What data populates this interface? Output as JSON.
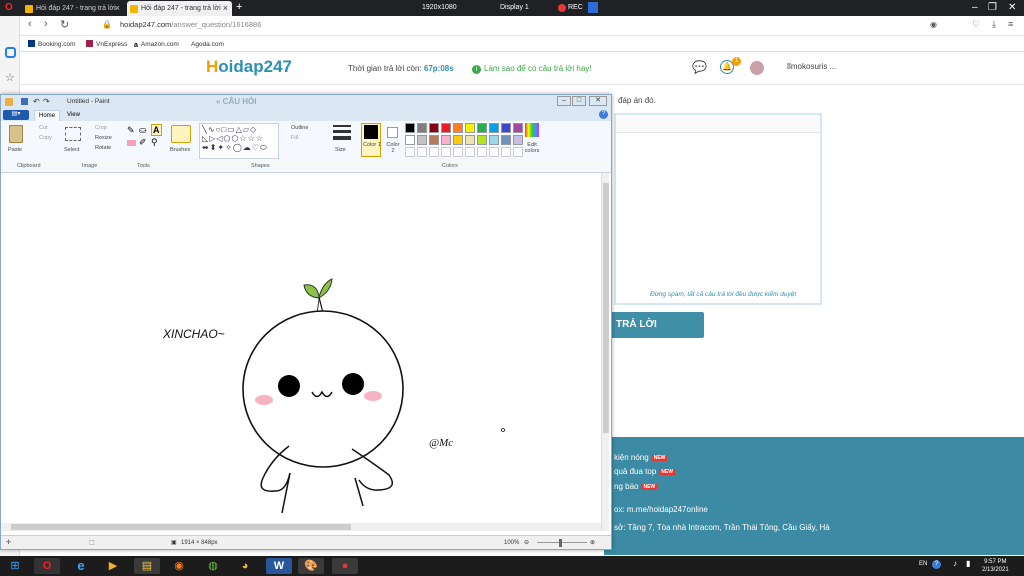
{
  "browser": {
    "tabs": [
      {
        "title": "Hỏi đáp 247 - trang trả lời"
      },
      {
        "title": "Hỏi đáp 247 - trang trả lời"
      }
    ],
    "url_host": "hoidap247.com",
    "url_path": "/answer_question/1616886",
    "bookmarks": [
      "Booking.com",
      "VnExpress",
      "Amazon.com",
      "Agoda.com"
    ],
    "recording": {
      "resolution": "1920x1080",
      "display": "Display 1",
      "rec_label": "REC"
    }
  },
  "site": {
    "logo_main": "oidap247",
    "logo_h": "H",
    "timer_label": "Thời gian trả lời còn:",
    "timer_value": "67p:08s",
    "howto": "Làm sao để có câu trả lời hay!",
    "notif_count": "1",
    "username": "ʬmokosuris ...",
    "notice": "đáp án đó.",
    "editor_note": "Đừng spam, tất cả câu trả lời đều được kiểm duyệt",
    "answer_button": "TRẢ LỜI",
    "footer_links": [
      {
        "label": "kiện nóng",
        "badge": "NEW"
      },
      {
        "label": "quả đua top",
        "badge": "NEW"
      },
      {
        "label": "ng báo",
        "badge": "NEW"
      }
    ],
    "footer_contact": "ox: m.me/hoidap247online",
    "footer_address": "sở: Tầng 7, Tòa nhà Intracom, Trần Thái Tông, Cầu Giấy, Hà"
  },
  "paint": {
    "title": "Untitled - Paint",
    "tabs": [
      "Home",
      "View"
    ],
    "clipboard": {
      "paste": "Paste",
      "cut": "Cut",
      "copy": "Copy",
      "group": "Clipboard"
    },
    "image": {
      "select": "Select",
      "crop": "Crop",
      "resize": "Resize",
      "rotate": "Rotate",
      "group": "Image"
    },
    "tools_group": "Tools",
    "brushes": "Brushes",
    "shapes": {
      "outline": "Outline",
      "fill": "Fill",
      "group": "Shapes"
    },
    "size": "Size",
    "color1": "Color 1",
    "color2": "Color 2",
    "edit_colors": "Edit colors",
    "colors_group": "Colors",
    "palette_row1": [
      "#000000",
      "#7f7f7f",
      "#880015",
      "#ed1c24",
      "#ff7f27",
      "#fff200",
      "#22b14c",
      "#00a2e8",
      "#3f48cc",
      "#a349a4"
    ],
    "palette_row2": [
      "#ffffff",
      "#c3c3c3",
      "#b97a57",
      "#ffaec9",
      "#ffc90e",
      "#efe4b0",
      "#b5e61d",
      "#99d9ea",
      "#7092be",
      "#c8bfe7"
    ],
    "drawing": {
      "greeting": "XINCHAO~",
      "signature": "@Mc"
    },
    "status_size": "1914 × 848px",
    "zoom": "100%",
    "header_fragment": "« CÂU HỎI"
  },
  "taskbar": {
    "time": "9:57 PM",
    "date": "2/13/2021",
    "lang": "EN"
  }
}
